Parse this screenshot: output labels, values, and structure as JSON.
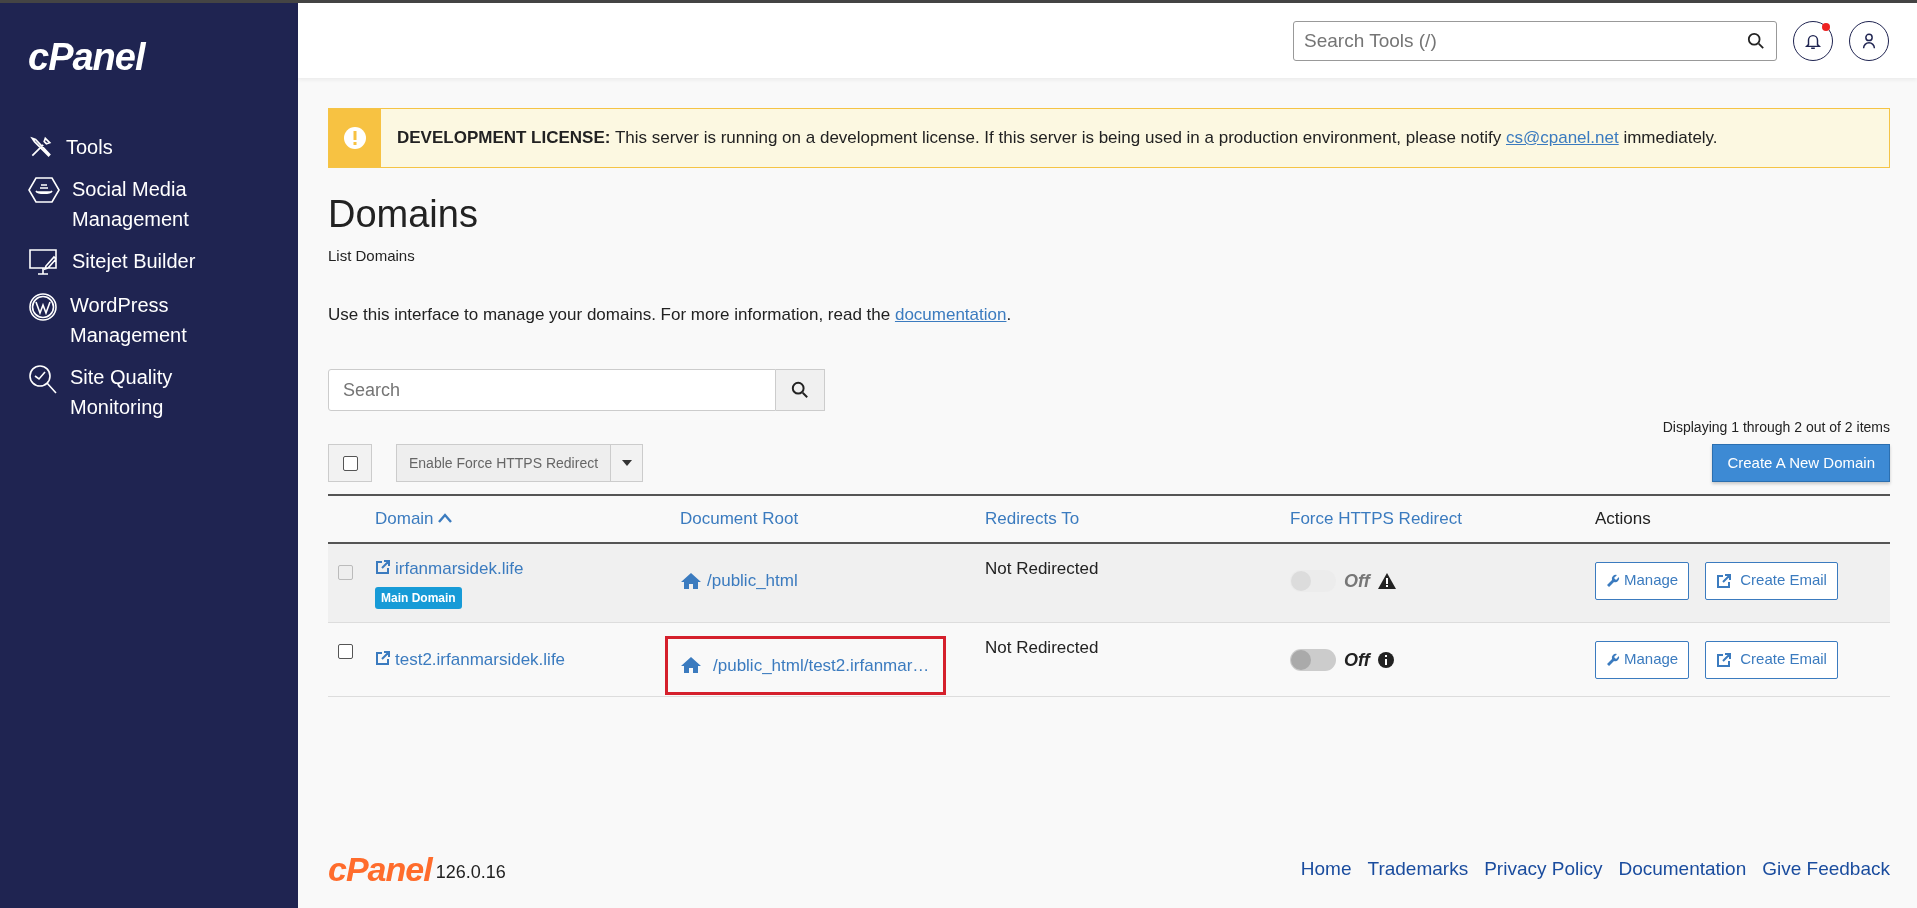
{
  "sidebar": {
    "logo": "cPanel",
    "items": [
      {
        "label": "Tools",
        "kind": "tools"
      },
      {
        "label": "Social Media Management",
        "kind": "social"
      },
      {
        "label": "Sitejet Builder",
        "kind": "builder"
      },
      {
        "label": "WordPress Management",
        "kind": "wordpress"
      },
      {
        "label": "Site Quality Monitoring",
        "kind": "quality"
      }
    ]
  },
  "header": {
    "search": {
      "placeholder": "Search Tools (/)"
    },
    "notifications": {
      "unread": true
    }
  },
  "alert": {
    "text": "**DEVELOPMENT LICENSE:** This server is running on a development license. If this server is being used in a production environment, please notify",
    "link": "cs@cpanel.net",
    "after": "immediately."
  },
  "page": {
    "title": "Domains",
    "subtitle": "List Domains",
    "intro": "Use this interface to manage your domains. For more information, read the",
    "intro_link": "documentation",
    "intro_end": "."
  },
  "search": {
    "placeholder": "Search"
  },
  "pagination_text": "Displaying 1 through 2 out of 2 items",
  "toolbar": {
    "select_all": {
      "checked": false
    },
    "bulk_action": "Enable Force HTTPS Redirect",
    "create_button": "Create A New Domain"
  },
  "table": {
    "columns": [
      {
        "label": "Domain",
        "sorted": true,
        "link": true
      },
      {
        "label": "Document Root",
        "sorted": false,
        "link": true
      },
      {
        "label": "Redirects To",
        "sorted": false,
        "link": true
      },
      {
        "label": "Force HTTPS Redirect",
        "sorted": false,
        "link": true
      },
      {
        "label": "Actions",
        "sorted": false,
        "link": false
      }
    ],
    "rows": [
      {
        "domain": "irfanmarsidek.life",
        "badge": "Main Domain",
        "checked": false,
        "disabled": true,
        "document_root": "/public_html",
        "highlighted": false,
        "redirects_to": "Not Redirected",
        "https": {
          "on": false,
          "label": "Off",
          "disabled": true,
          "kind": "warning"
        },
        "actions": [
          "Manage",
          "Create Email"
        ]
      },
      {
        "domain": "test2.irfanmarsidek.life",
        "checked": false,
        "disabled": false,
        "document_root": "/public_html/test2.irfanmar…",
        "highlighted": true,
        "redirects_to": "Not Redirected",
        "https": {
          "on": false,
          "label": "Off",
          "disabled": false,
          "kind": "info"
        },
        "actions": [
          "Manage",
          "Create Email"
        ]
      }
    ]
  },
  "footer": {
    "logo": "cPanel",
    "version": "126.0.16",
    "links": [
      "Home",
      "Trademarks",
      "Privacy Policy",
      "Documentation",
      "Give Feedback"
    ]
  }
}
